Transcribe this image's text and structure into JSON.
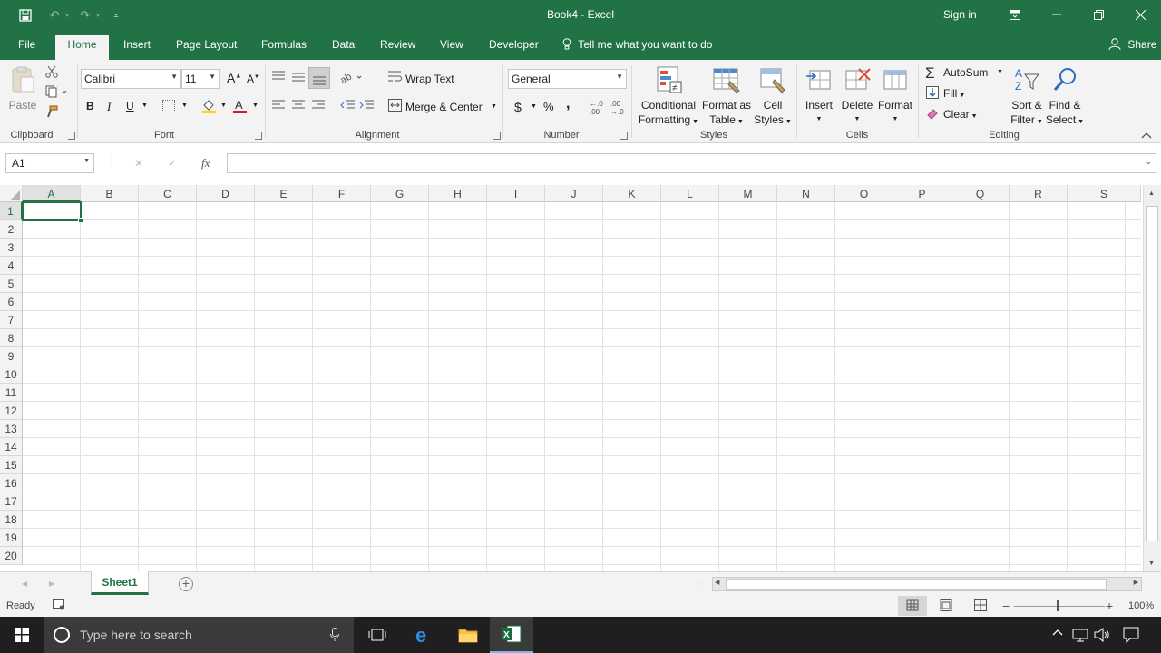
{
  "titlebar": {
    "title": "Book4  -  Excel",
    "signin": "Sign in",
    "save_icon": "save-icon",
    "undo_icon": "undo-icon",
    "redo_icon": "redo-icon",
    "customize_icon": "customize-qat-icon"
  },
  "tabs": {
    "file": "File",
    "home": "Home",
    "insert": "Insert",
    "page_layout": "Page Layout",
    "formulas": "Formulas",
    "data": "Data",
    "review": "Review",
    "view": "View",
    "developer": "Developer",
    "tellme": "Tell me what you want to do",
    "share": "Share"
  },
  "ribbon": {
    "clipboard": {
      "paste": "Paste",
      "label": "Clipboard"
    },
    "font": {
      "name": "Calibri",
      "size": "11",
      "bold": "B",
      "italic": "I",
      "underline": "U",
      "grow": "A",
      "shrink": "A",
      "label": "Font"
    },
    "alignment": {
      "wrap_text": "Wrap Text",
      "merge_center": "Merge & Center",
      "label": "Alignment"
    },
    "number": {
      "format": "General",
      "currency": "$",
      "percent": "%",
      "comma": ",",
      "label": "Number"
    },
    "styles": {
      "conditional_1": "Conditional",
      "conditional_2": "Formatting",
      "format_table_1": "Format as",
      "format_table_2": "Table",
      "cell_styles_1": "Cell",
      "cell_styles_2": "Styles",
      "label": "Styles"
    },
    "cells": {
      "insert": "Insert",
      "delete": "Delete",
      "format": "Format",
      "label": "Cells"
    },
    "editing": {
      "autosum": "AutoSum",
      "fill": "Fill",
      "clear": "Clear",
      "sort_1": "Sort &",
      "sort_2": "Filter",
      "find_1": "Find &",
      "find_2": "Select",
      "label": "Editing"
    }
  },
  "formula_bar": {
    "name_box": "A1",
    "cancel": "✕",
    "enter": "✓",
    "fx": "fx",
    "value": ""
  },
  "grid": {
    "columns": [
      "A",
      "B",
      "C",
      "D",
      "E",
      "F",
      "G",
      "H",
      "I",
      "J",
      "K",
      "L",
      "M",
      "N",
      "O",
      "P",
      "Q",
      "R",
      "S"
    ],
    "rows": [
      "1",
      "2",
      "3",
      "4",
      "5",
      "6",
      "7",
      "8",
      "9",
      "10",
      "11",
      "12",
      "13",
      "14",
      "15",
      "16",
      "17",
      "18",
      "19",
      "20"
    ],
    "selected_cell": "A1"
  },
  "sheets": {
    "active": "Sheet1",
    "add_icon": "add-sheet-icon"
  },
  "status": {
    "text": "Ready",
    "zoom": "100%"
  },
  "taskbar": {
    "search_placeholder": "Type here to search"
  },
  "colors": {
    "brand": "#217346",
    "ribbon_bg": "#f3f3f3",
    "taskbar": "#1f1f1f"
  }
}
